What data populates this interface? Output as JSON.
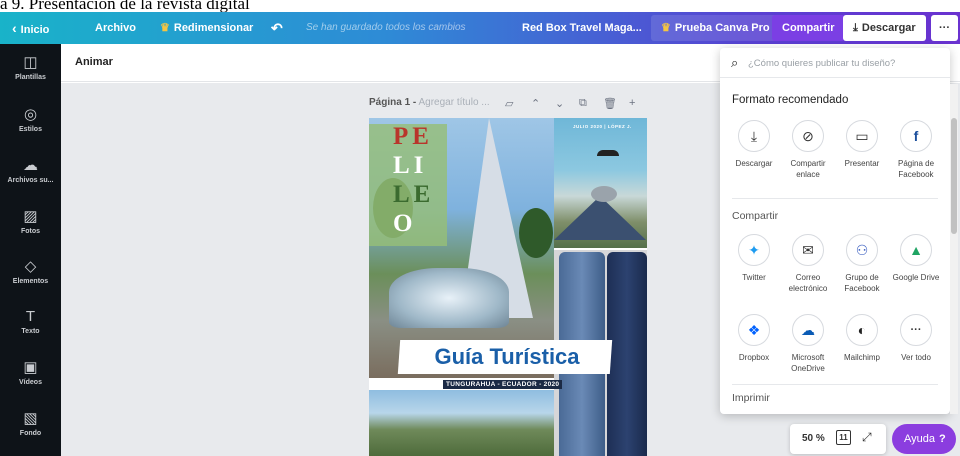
{
  "caption": {
    "text": "a 9. Presentación de la revista digital"
  },
  "topbar": {
    "back_label": "Inicio",
    "file_label": "Archivo",
    "resize_label": "Redimensionar",
    "undo_icon": "undo-icon",
    "saved_status": "Se han guardado todos los cambios",
    "doc_title": "Red Box Travel Maga...",
    "pro_label": "Prueba Canva Pro",
    "share_label": "Compartir",
    "download_label": "Descargar",
    "more_label": "···"
  },
  "sidebar": {
    "items": [
      {
        "label": "Plantillas",
        "icon": "templates-icon",
        "glyph": "◫"
      },
      {
        "label": "Estilos",
        "icon": "styles-icon",
        "glyph": "◎"
      },
      {
        "label": "Archivos su...",
        "icon": "upload-icon",
        "glyph": "☁"
      },
      {
        "label": "Fotos",
        "icon": "photos-icon",
        "glyph": "▨"
      },
      {
        "label": "Elementos",
        "icon": "elements-icon",
        "glyph": "◇"
      },
      {
        "label": "Texto",
        "icon": "text-icon",
        "glyph": "T"
      },
      {
        "label": "Vídeos",
        "icon": "videos-icon",
        "glyph": "▣"
      },
      {
        "label": "Fondo",
        "icon": "background-icon",
        "glyph": "▧"
      }
    ]
  },
  "toolbar": {
    "animate_label": "Animar"
  },
  "page": {
    "label": "Página 1 -",
    "title_placeholder": "Agregar título ..."
  },
  "magazine": {
    "title_line1": "PE",
    "title_line2": "LI",
    "title_line3": "LE",
    "title_line4": "O",
    "top_text": "JULIO 2020 | LÓPEZ J.",
    "banner": "Guía Turística",
    "subtitle": "TUNGURAHUA - ECUADOR - 2020"
  },
  "publish_panel": {
    "search_placeholder": "¿Cómo quieres publicar tu diseño?",
    "recommended_title": "Formato recomendado",
    "recommended": [
      {
        "label": "Descargar",
        "icon": "download-icon",
        "glyph": "⤓"
      },
      {
        "label": "Compartir enlace",
        "icon": "link-icon",
        "glyph": "⊘"
      },
      {
        "label": "Presentar",
        "icon": "present-icon",
        "glyph": "▭"
      },
      {
        "label": "Página de Facebook",
        "icon": "facebook-icon",
        "glyph": "f"
      }
    ],
    "share_title": "Compartir",
    "share": [
      {
        "label": "Twitter",
        "icon": "twitter-icon",
        "glyph": "✦"
      },
      {
        "label": "Correo electrónico",
        "icon": "email-icon",
        "glyph": "✉"
      },
      {
        "label": "Grupo de Facebook",
        "icon": "facebook-group-icon",
        "glyph": "⚇"
      },
      {
        "label": "Google Drive",
        "icon": "google-drive-icon",
        "glyph": "▲"
      },
      {
        "label": "Dropbox",
        "icon": "dropbox-icon",
        "glyph": "❖"
      },
      {
        "label": "Microsoft OneDrive",
        "icon": "onedrive-icon",
        "glyph": "☁"
      },
      {
        "label": "Mailchimp",
        "icon": "mailchimp-icon",
        "glyph": "◐"
      },
      {
        "label": "Ver todo",
        "icon": "more-icon",
        "glyph": "···"
      }
    ],
    "print_title": "Imprimir"
  },
  "zoom": {
    "value": "50 %",
    "page_count": "11"
  },
  "help": {
    "label": "Ayuda",
    "mark": "?"
  },
  "colors": {
    "topbar_start": "#19b3c9",
    "topbar_end": "#6a32d0",
    "share_button": "#7b3fe4",
    "help_button": "#8b3ddf",
    "sidebar": "#0e1318"
  }
}
